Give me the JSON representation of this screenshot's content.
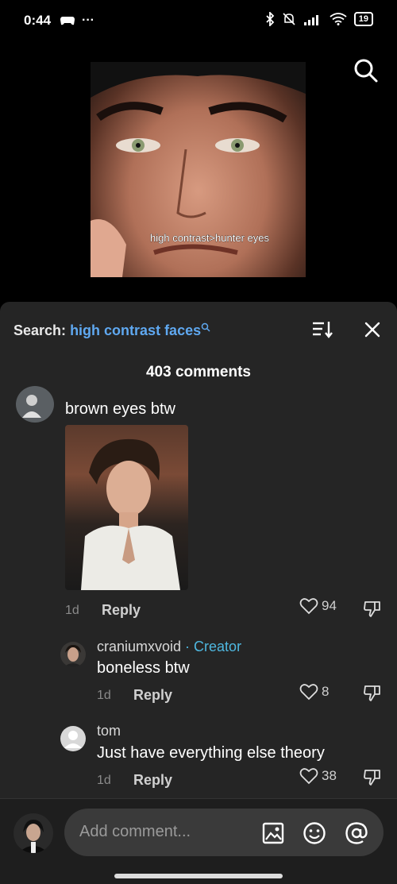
{
  "status_bar": {
    "time": "0:44",
    "battery": "19"
  },
  "video": {
    "caption": "high contrast>hunter eyes"
  },
  "header": {
    "search_prefix": "Search:",
    "search_query": "high contrast faces",
    "comment_count": "403 comments"
  },
  "comments": [
    {
      "text": "brown eyes btw",
      "time": "1d",
      "reply": "Reply",
      "likes": "94"
    },
    {
      "user": "craniumxvoid",
      "creator_tag": " · Creator",
      "text": "boneless btw",
      "time": "1d",
      "reply": "Reply",
      "likes": "8"
    },
    {
      "user": "tom",
      "text": "Just have everything else theory",
      "time": "1d",
      "reply": "Reply",
      "likes": "38"
    }
  ],
  "input": {
    "placeholder": "Add comment..."
  },
  "colors": {
    "accent": "#5fa8f0",
    "creator": "#4fb8e0",
    "sheet_bg": "#252525"
  }
}
